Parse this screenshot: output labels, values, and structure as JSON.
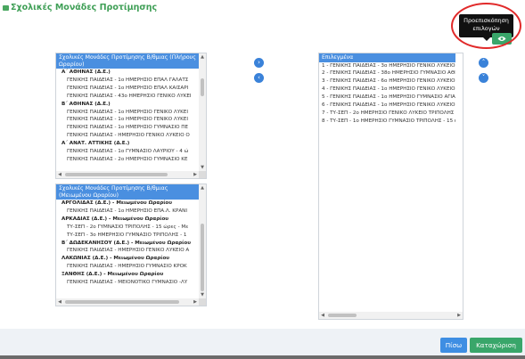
{
  "header": {
    "title": "Σχολικές Μονάδες Προτίμησης"
  },
  "preview": {
    "tooltip_line1": "Προεπισκόπηση",
    "tooltip_line2": "επιλογών",
    "icon": "eye-icon"
  },
  "left_top": {
    "header": "Σχολικές Μονάδες Προτίμησης Β/θμιας (Πλήρους Ωραρίου)",
    "rows": [
      {
        "type": "group",
        "text": "Α΄ ΑΘΗΝΑΣ (Δ.Ε.)"
      },
      {
        "type": "item",
        "text": "ΓΕΝΙΚΗΣ ΠΑΙΔΕΙΑΣ - 1ο ΗΜΕΡΗΣΙΟ ΕΠΑΛ ΓΑΛΑΤΣ"
      },
      {
        "type": "item",
        "text": "ΓΕΝΙΚΗΣ ΠΑΙΔΕΙΑΣ - 1ο ΗΜΕΡΗΣΙΟ ΕΠΑΛ ΚΑΙΣΑΡΙ"
      },
      {
        "type": "item",
        "text": "ΓΕΝΙΚΗΣ ΠΑΙΔΕΙΑΣ - 43ο ΗΜΕΡΗΣΙΟ ΓΕΝΙΚΟ ΛΥΚΕΙ"
      },
      {
        "type": "group",
        "text": "Β΄ ΑΘΗΝΑΣ (Δ.Ε.)"
      },
      {
        "type": "item",
        "text": "ΓΕΝΙΚΗΣ ΠΑΙΔΕΙΑΣ - 1ο ΗΜΕΡΗΣΙΟ ΓΕΝΙΚΟ ΛΥΚΕΙ"
      },
      {
        "type": "item",
        "text": "ΓΕΝΙΚΗΣ ΠΑΙΔΕΙΑΣ - 1ο ΗΜΕΡΗΣΙΟ ΓΕΝΙΚΟ ΛΥΚΕΙ"
      },
      {
        "type": "item",
        "text": "ΓΕΝΙΚΗΣ ΠΑΙΔΕΙΑΣ - 1ο ΗΜΕΡΗΣΙΟ ΓΥΜΝΑΣΙΟ ΠΕ"
      },
      {
        "type": "item",
        "text": "ΓΕΝΙΚΗΣ ΠΑΙΔΕΙΑΣ - ΗΜΕΡΗΣΙΟ ΓΕΝΙΚΟ ΛΥΚΕΙΟ Ο"
      },
      {
        "type": "group",
        "text": "Α΄ ΑΝΑΤ. ΑΤΤΙΚΗΣ (Δ.Ε.)"
      },
      {
        "type": "item",
        "text": "ΓΕΝΙΚΗΣ ΠΑΙΔΕΙΑΣ - 1ο ΓΥΜΝΑΣΙΟ ΛΑΥΡΙΟΥ - 4 ώ"
      },
      {
        "type": "item",
        "text": "ΓΕΝΙΚΗΣ ΠΑΙΔΕΙΑΣ - 2ο ΗΜΕΡΗΣΙΟ ΓΥΜΝΑΣΙΟ ΚΕ"
      }
    ]
  },
  "left_bottom": {
    "header": "Σχολικές Μονάδες Προτίμησης Β/θμιας (Μειωμένου Ωραρίου)",
    "rows": [
      {
        "type": "group",
        "text": "ΑΡΓΟΛΙΔΑΣ (Δ.Ε.) - Μειωμένου Ωραρίου"
      },
      {
        "type": "item",
        "text": "ΓΕΝΙΚΗΣ ΠΑΙΔΕΙΑΣ - 1ο ΗΜΕΡΗΣΙΟ ΕΠΑ.Λ. ΚΡΑΝΙ"
      },
      {
        "type": "group",
        "text": "ΑΡΚΑΔΙΑΣ (Δ.Ε.) - Μειωμένου Ωραρίου"
      },
      {
        "type": "item",
        "text": "ΤΥ-ΣΕΠ - 2ο ΓΥΜΝΑΣΙΟ ΤΡΙΠΟΛΗΣ - 15 ώρες - Με"
      },
      {
        "type": "item",
        "text": "ΤΥ-ΣΕΠ - 3ο ΗΜΕΡΗΣΙΟ ΓΥΜΝΑΣΙΟ ΤΡΙΠΟΛΗΣ - 1"
      },
      {
        "type": "group",
        "text": "Β΄ ΔΩΔΕΚΑΝΗΣΟΥ (Δ.Ε.) - Μειωμένου Ωραρίου"
      },
      {
        "type": "item",
        "text": "ΓΕΝΙΚΗΣ ΠΑΙΔΕΙΑΣ - ΗΜΕΡΗΣΙΟ ΓΕΝΙΚΟ ΛΥΚΕΙΟ Α"
      },
      {
        "type": "group",
        "text": "ΛΑΚΩΝΙΑΣ (Δ.Ε.) - Μειωμένου Ωραρίου"
      },
      {
        "type": "item",
        "text": "ΓΕΝΙΚΗΣ ΠΑΙΔΕΙΑΣ - ΗΜΕΡΗΣΙΟ ΓΥΜΝΑΣΙΟ ΚΡΟΚ"
      },
      {
        "type": "group",
        "text": "ΞΑΝΘΗΣ (Δ.Ε.) - Μειωμένου Ωραρίου"
      },
      {
        "type": "item",
        "text": "ΓΕΝΙΚΗΣ ΠΑΙΔΕΙΑΣ - ΜΕΙΟΝΟΤΙΚΟ ΓΥΜΝΑΣΙΟ -ΛΥ"
      }
    ]
  },
  "selected": {
    "header": "Επιλεγμένα",
    "rows": [
      "1 - ΓΕΝΙΚΗΣ ΠΑΙΔΕΙΑΣ - 3ο ΗΜΕΡΗΣΙΟ ΓΕΝΙΚΟ ΛΥΚΕΙΟ",
      "2 - ΓΕΝΙΚΗΣ ΠΑΙΔΕΙΑΣ - 38ο ΗΜΕΡΗΣΙΟ ΓΥΜΝΑΣΙΟ ΑΘΙ",
      "3 - ΓΕΝΙΚΗΣ ΠΑΙΔΕΙΑΣ - 6ο ΗΜΕΡΗΣΙΟ ΓΕΝΙΚΟ ΛΥΚΕΙΟ",
      "4 - ΓΕΝΙΚΗΣ ΠΑΙΔΕΙΑΣ - 1ο ΗΜΕΡΗΣΙΟ ΓΕΝΙΚΟ ΛΥΚΕΙΟ",
      "5 - ΓΕΝΙΚΗΣ ΠΑΙΔΕΙΑΣ - 1ο ΗΜΕΡΗΣΙΟ ΓΥΜΝΑΣΙΟ ΑΓΙΑ",
      "6 - ΓΕΝΙΚΗΣ ΠΑΙΔΕΙΑΣ - 1ο ΗΜΕΡΗΣΙΟ ΓΕΝΙΚΟ ΛΥΚΕΙΟ",
      "7 - ΤΥ-ΣΕΠ - 2ο ΗΜΕΡΗΣΙΟ ΓΕΝΙΚΟ ΛΥΚΕΙΟ ΤΡΙΠΟΛΗΣ",
      "8 - ΤΥ-ΣΕΠ - 1ο ΗΜΕΡΗΣΙΟ ΓΥΜΝΑΣΙΟ ΤΡΙΠΟΛΗΣ - 15 ώ"
    ]
  },
  "arrows": {
    "right": "›",
    "left": "‹",
    "up": "˄",
    "down": "˅"
  },
  "footer": {
    "back_label": "Πίσω",
    "submit_label": "Καταχώριση"
  },
  "colors": {
    "accent_green": "#39a66a",
    "accent_blue": "#3e8ee3",
    "panel_header": "#4a8fe0",
    "highlight_ring": "#e12a2a"
  }
}
